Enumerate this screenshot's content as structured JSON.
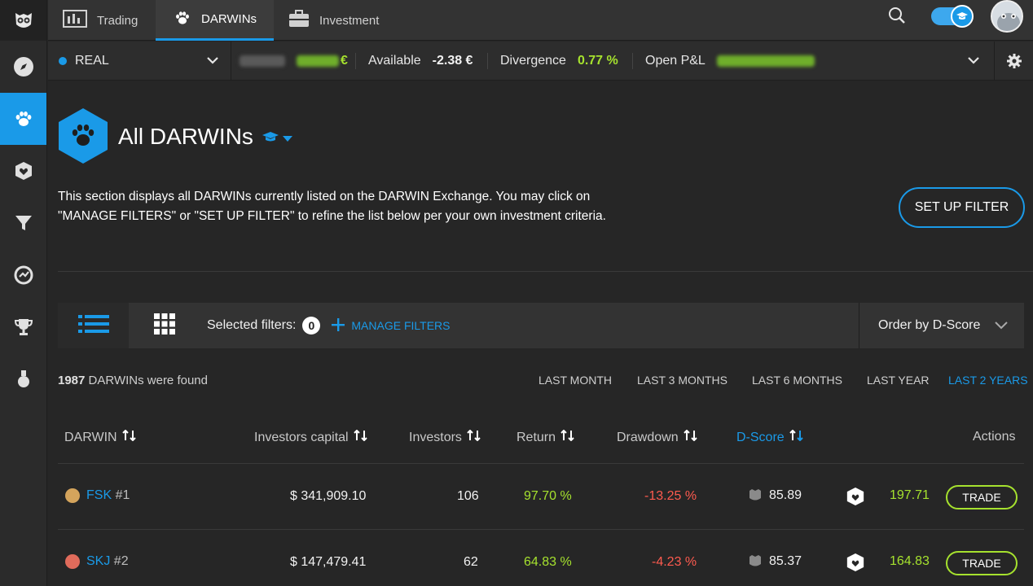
{
  "nav": {
    "tabs": [
      {
        "label": "Trading",
        "icon": "chart-icon"
      },
      {
        "label": "DARWINs",
        "icon": "paw-icon",
        "active": true
      },
      {
        "label": "Investment",
        "icon": "briefcase-icon"
      }
    ]
  },
  "account": {
    "name": "REAL",
    "available_label": "Available",
    "available_value": "-2.38 €",
    "divergence_label": "Divergence",
    "divergence_value": "0.77 %",
    "openpl_label": "Open P&L",
    "hidden_value_suffix": "€"
  },
  "page": {
    "title": "All DARWINs",
    "description": "This section displays all DARWINs currently listed on the DARWIN Exchange. You may click on \"MANAGE FILTERS\" or \"SET UP FILTER\" to refine the list below per your own investment criteria.",
    "setup_filter_label": "SET UP FILTER"
  },
  "filters": {
    "selected_label": "Selected filters:",
    "selected_count": "0",
    "manage_label": "MANAGE FILTERS",
    "order_label": "Order by D-Score"
  },
  "results": {
    "count": "1987",
    "count_suffix": " DARWINs were found"
  },
  "periods": [
    "LAST MONTH",
    "LAST 3 MONTHS",
    "LAST 6 MONTHS",
    "LAST YEAR",
    "LAST 2 YEARS"
  ],
  "active_period": "LAST 2 YEARS",
  "table": {
    "headers": {
      "darwin": "DARWIN",
      "capital": "Investors capital",
      "investors": "Investors",
      "return": "Return",
      "drawdown": "Drawdown",
      "dscore": "D-Score",
      "actions": "Actions"
    },
    "rows": [
      {
        "name": "FSK",
        "rank": "#1",
        "dot_color": "#d4a45c",
        "capital": "$ 341,909.10",
        "investors": "106",
        "return": "97.70 %",
        "drawdown": "-13.25 %",
        "dscore": "85.89",
        "value": "197.71",
        "action": "TRADE"
      },
      {
        "name": "SKJ",
        "rank": "#2",
        "dot_color": "#e06b5b",
        "capital": "$ 147,479.41",
        "investors": "62",
        "return": "64.83 %",
        "drawdown": "-4.23 %",
        "dscore": "85.37",
        "value": "164.83",
        "action": "TRADE"
      }
    ]
  },
  "colors": {
    "accent": "#1a9ae8",
    "positive": "#a6e22e",
    "negative": "#ff5b4f"
  }
}
